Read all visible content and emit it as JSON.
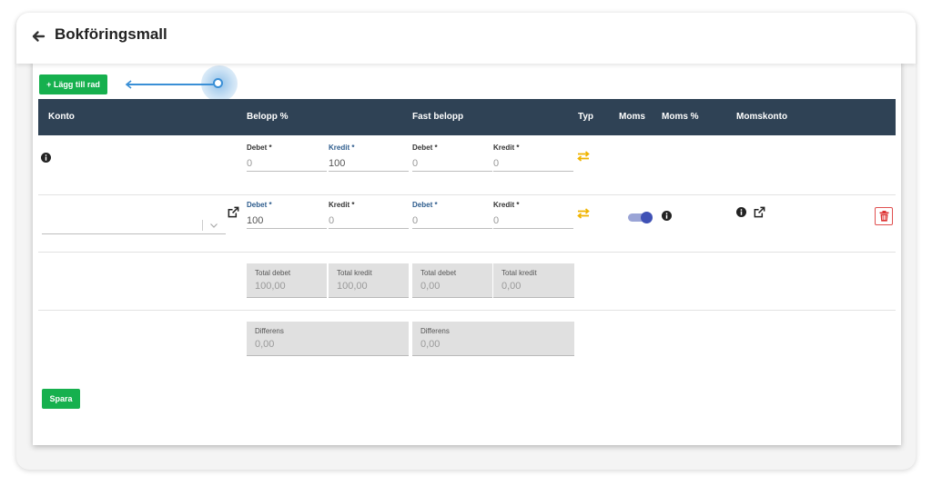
{
  "header": {
    "title": "Bokföringsmall"
  },
  "toolbar": {
    "add_row_label": "+ Lägg till rad"
  },
  "table": {
    "headers": [
      "Konto",
      "Belopp %",
      "Fast belopp",
      "Typ",
      "Moms",
      "Moms %",
      "Momskonto"
    ]
  },
  "row1": {
    "belopp": {
      "debet_label": "Debet *",
      "debet_value": "0",
      "kredit_label": "Kredit *",
      "kredit_value": "100"
    },
    "fast": {
      "debet_label": "Debet *",
      "debet_value": "0",
      "kredit_label": "Kredit *",
      "kredit_value": "0"
    }
  },
  "row2": {
    "belopp": {
      "debet_label": "Debet *",
      "debet_value": "100",
      "kredit_label": "Kredit *",
      "kredit_value": "0"
    },
    "fast": {
      "debet_label": "Debet *",
      "debet_value": "0",
      "kredit_label": "Kredit *",
      "kredit_value": "0"
    },
    "moms_enabled": true
  },
  "totals": [
    {
      "label": "Total debet",
      "value": "100,00"
    },
    {
      "label": "Total kredit",
      "value": "100,00"
    },
    {
      "label": "Total debet",
      "value": "0,00"
    },
    {
      "label": "Total kredit",
      "value": "0,00"
    }
  ],
  "differences": [
    {
      "label": "Differens",
      "value": "0,00"
    },
    {
      "label": "Differens",
      "value": "0,00"
    }
  ],
  "footer": {
    "save_label": "Spara"
  },
  "colors": {
    "green": "#16b04e",
    "header_bg": "#2f4255",
    "swap": "#f0b400",
    "toggle": "#3f51b5",
    "delete": "#e05050",
    "pointer": "#3a8fd6"
  },
  "icons": [
    "back-arrow-icon",
    "info-icon",
    "swap-icon",
    "external-link-icon",
    "chevron-down-icon",
    "trash-icon"
  ]
}
